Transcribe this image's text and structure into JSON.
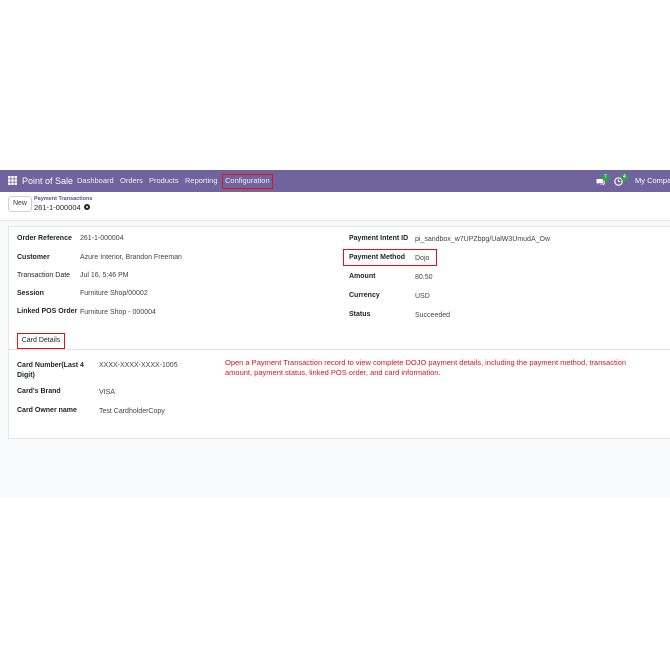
{
  "navbar": {
    "app_name": "Point of Sale",
    "menu": [
      "Dashboard",
      "Orders",
      "Products",
      "Reporting",
      "Configuration"
    ],
    "chat_badge": "7",
    "activity_badge": "4",
    "company": "My Company"
  },
  "control": {
    "new_label": "New",
    "breadcrumb_parent": "Payment Transactions",
    "breadcrumb_current": "261-1-000004"
  },
  "left_fields": [
    {
      "label": "Order Reference",
      "value": "261-1-000004"
    },
    {
      "label": "Customer",
      "value": "Azure Interior, Brandon Freeman"
    },
    {
      "label": "Transaction Date",
      "value": "Jul 16, 5:46 PM"
    },
    {
      "label": "Session",
      "value": "Furniture Shop/00002"
    },
    {
      "label": "Linked POS Order",
      "value": "Furniture Shop - 000004"
    }
  ],
  "right_fields": [
    {
      "label": "Payment Intent ID",
      "value": "pi_sandbox_w7UPZbpg/UalW3UmudA_Ow"
    },
    {
      "label": "Payment Method",
      "value": "Dojo"
    },
    {
      "label": "Amount",
      "value": "80.50"
    },
    {
      "label": "Currency",
      "value": "USD"
    },
    {
      "label": "Status",
      "value": "Succeeded"
    }
  ],
  "tab_label": "Card Details",
  "card_fields": [
    {
      "label": "Card Number(Last 4 Digit)",
      "value": "XXXX-XXXX-XXXX-1005"
    },
    {
      "label": "Card's Brand",
      "value": "VISA"
    },
    {
      "label": "Card Owner name",
      "value": "Test CardholderCopy"
    }
  ],
  "annotation": "Open a Payment Transaction record to view complete DOJO payment details, including the payment method, transaction amount, payment status, linked POS order, and card information.",
  "colors": {
    "navbar": "#71639e",
    "highlight": "#e0111b",
    "badge": "#28a745"
  }
}
